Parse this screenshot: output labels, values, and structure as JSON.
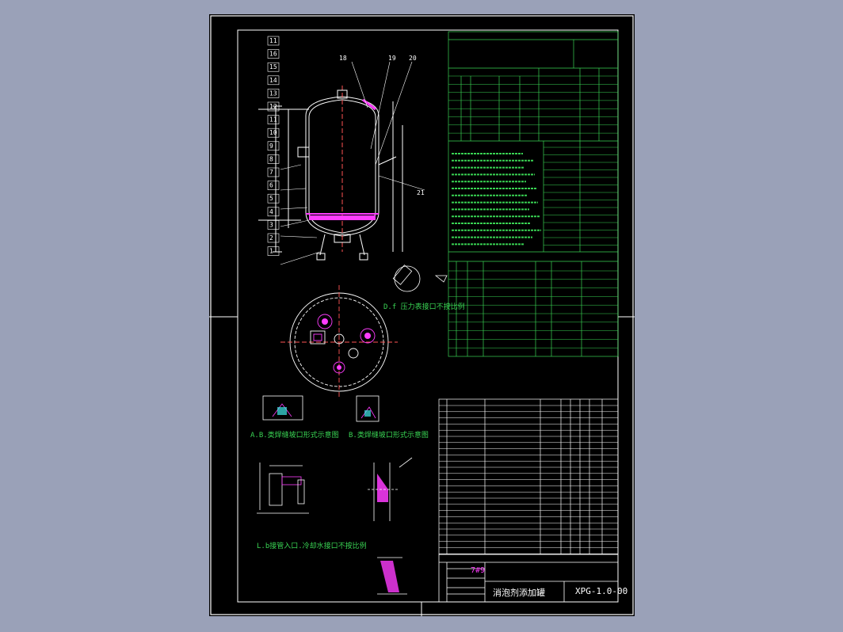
{
  "drawing": {
    "title": "消泡剂添加罐",
    "code": "XPG-1.0-00",
    "mass_label": "7#9",
    "notes": {
      "nozzle_f": "D.f 压力表接口不按比例",
      "weld_a": "A.B.类焊缝坡口形式示意图",
      "weld_b": "B.类焊缝坡口形式示意图",
      "nozzle_lbd": "L.b接管入口.冷却水接口不按比例"
    },
    "callouts_left": [
      "11",
      "16",
      "15",
      "14",
      "13",
      "12",
      "11",
      "10",
      "9",
      "8",
      "7",
      "6",
      "5",
      "4",
      "3",
      "2",
      "1"
    ],
    "callouts_top": [
      "18",
      "19",
      "20"
    ],
    "callout_right": "21",
    "colors": {
      "sheet": "#000000",
      "background": "#9aa1b8",
      "line": "#ffffff",
      "table": "#39d353",
      "heading": "#ff3cff",
      "vessel": "#ffffff",
      "detail": "#ff3cff"
    }
  }
}
